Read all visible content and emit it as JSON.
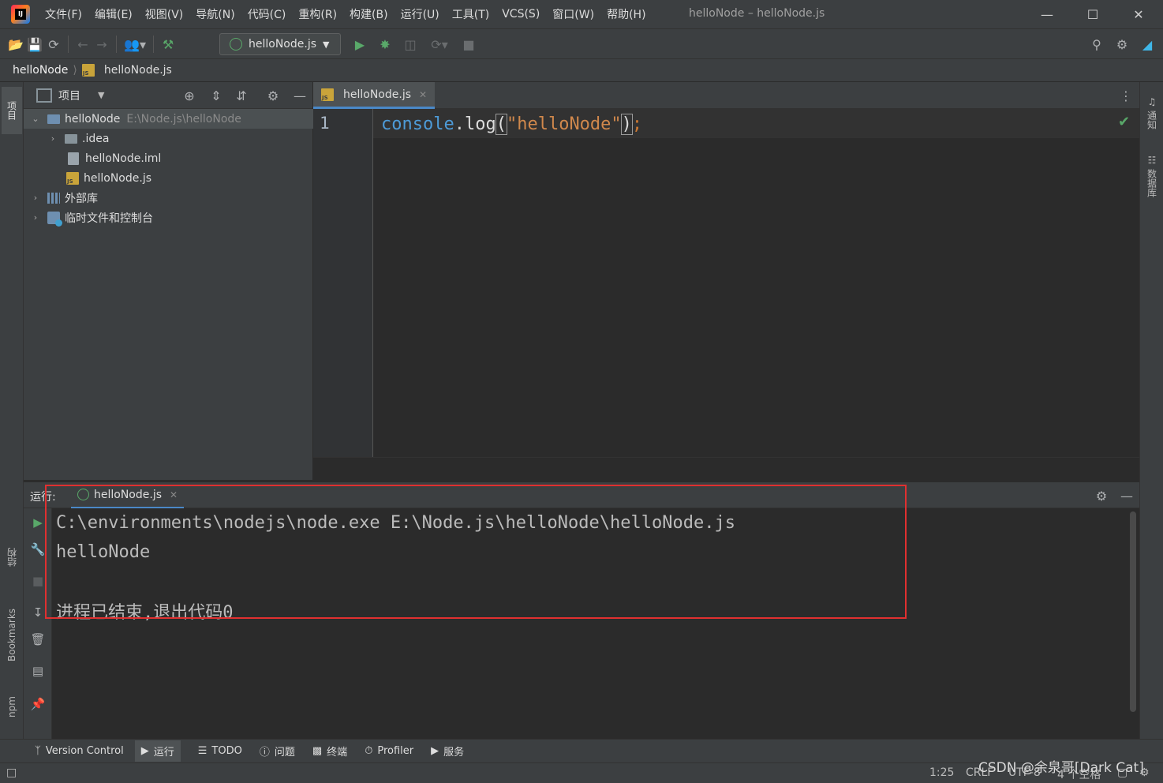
{
  "menu": [
    "文件(F)",
    "编辑(E)",
    "视图(V)",
    "导航(N)",
    "代码(C)",
    "重构(R)",
    "构建(B)",
    "运行(U)",
    "工具(T)",
    "VCS(S)",
    "窗口(W)",
    "帮助(H)"
  ],
  "app_title": "helloNode – helloNode.js",
  "run_config": "helloNode.js",
  "breadcrumb": {
    "project": "helloNode",
    "file": "helloNode.js"
  },
  "left_stripe": {
    "project": "项目",
    "structure": "结构",
    "bookmarks": "Bookmarks",
    "npm": "npm"
  },
  "right_stripe": {
    "notifications": "通知",
    "database": "数据库"
  },
  "project_panel": {
    "title": "项目",
    "tree": [
      {
        "label": "helloNode",
        "hint": "E:\\Node.js\\helloNode"
      },
      {
        "label": ".idea"
      },
      {
        "label": "helloNode.iml"
      },
      {
        "label": "helloNode.js"
      },
      {
        "label": "外部库"
      },
      {
        "label": "临时文件和控制台"
      }
    ]
  },
  "editor": {
    "tab": "helloNode.js",
    "line_number": "1",
    "code": {
      "obj": "console",
      "dot": ".",
      "method": "log",
      "open": "(",
      "string": "\"helloNode\"",
      "close": ")",
      "semi": ";"
    }
  },
  "run_panel": {
    "label": "运行:",
    "tab": "helloNode.js",
    "console": [
      "C:\\environments\\nodejs\\node.exe E:\\Node.js\\helloNode\\helloNode.js",
      "helloNode",
      "",
      "进程已结束,退出代码0"
    ]
  },
  "bottom_tools": [
    "Version Control",
    "运行",
    "TODO",
    "问题",
    "终端",
    "Profiler",
    "服务"
  ],
  "status": {
    "position": "1:25",
    "line_sep": "CRLF",
    "encoding": "UTF-8",
    "indent": "4 个空格"
  },
  "watermark": "CSDN @余泉哥[Dark Cat]",
  "colors": {
    "keyword_blue": "#4d9bd8",
    "method": "#d6d6d6",
    "string": "#d0884c",
    "accent": "#4a88c7",
    "run_green": "#59a869",
    "highlight_red": "#e03030"
  }
}
